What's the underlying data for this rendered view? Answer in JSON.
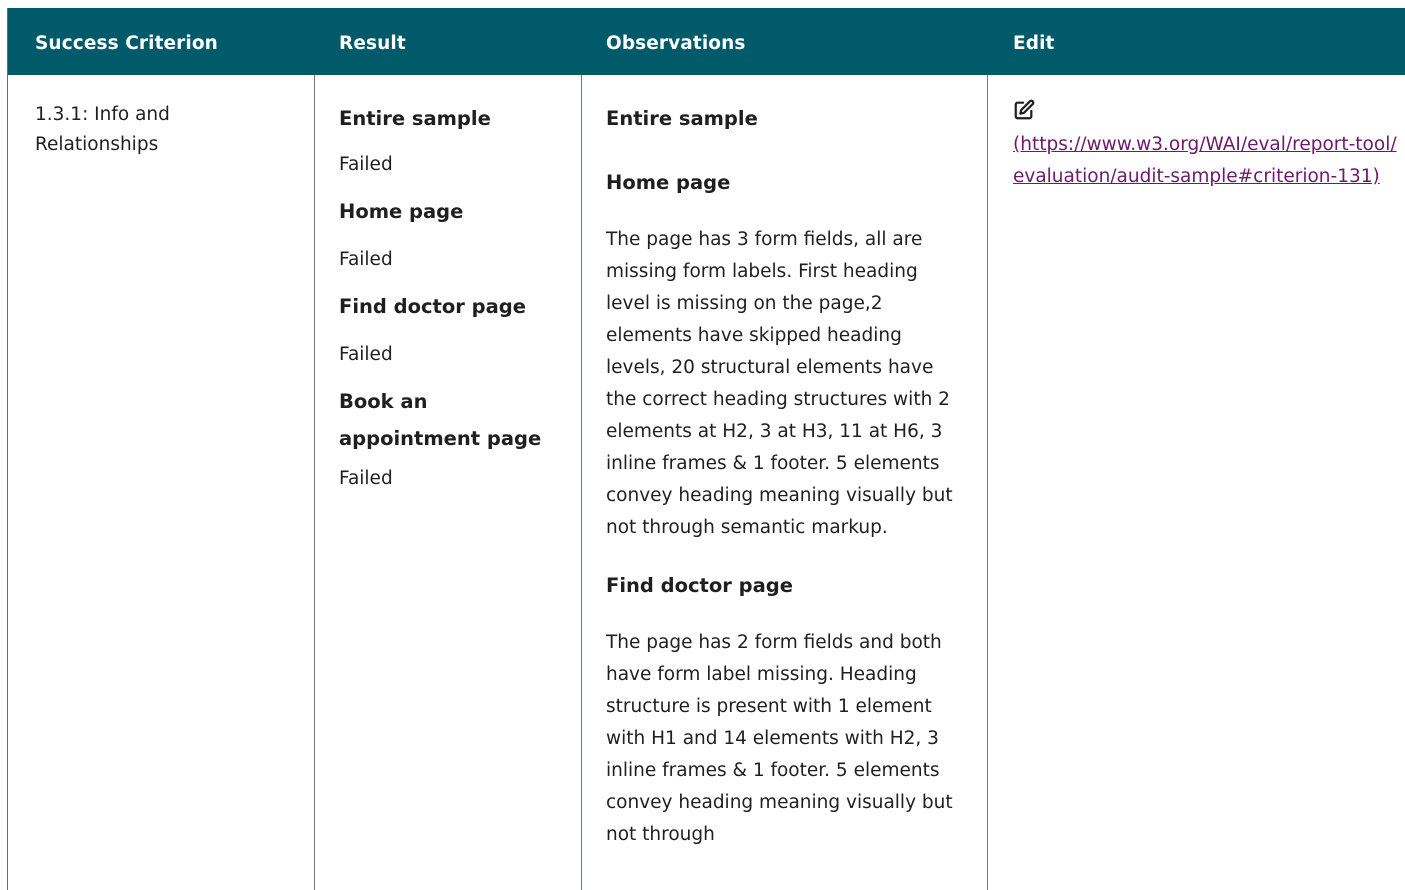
{
  "table": {
    "headers": [
      "Success Criterion",
      "Result",
      "Observations",
      "Edit"
    ],
    "row": {
      "criterion": "1.3.1: Info and Relationships",
      "results": [
        {
          "label": "Entire sample",
          "value": "Failed"
        },
        {
          "label": "Home page",
          "value": "Failed"
        },
        {
          "label": "Find doctor page",
          "value": "Failed"
        },
        {
          "label": "Book an appointment page",
          "value": "Failed"
        }
      ],
      "observations": {
        "entire_sample_label": "Entire sample",
        "home_label": "Home page",
        "home_text": "The page has 3 form fields, all are missing form labels. First heading level is missing on the page,2 elements have skipped heading levels, 20 structural elements have the correct heading structures with 2 elements at H2, 3 at H3, 11 at H6, 3 inline frames & 1 footer. 5 elements convey heading meaning visually but not through semantic markup.",
        "find_doctor_label": "Find doctor page",
        "find_doctor_text": "The page has 2 form fields and both have form label missing. Heading structure is present with 1 element with H1 and 14 elements with H2, 3 inline frames & 1 footer. 5 elements convey heading meaning visually but not through"
      },
      "edit": {
        "icon": "edit-icon",
        "link_text": "(https://www.w3.org/WAI/eval/report-tool/evaluation/audit-sample#criterion-131)"
      }
    }
  },
  "colors": {
    "header_bg": "#005a6a",
    "header_text": "#ffffff",
    "link": "#6b1a6b"
  }
}
